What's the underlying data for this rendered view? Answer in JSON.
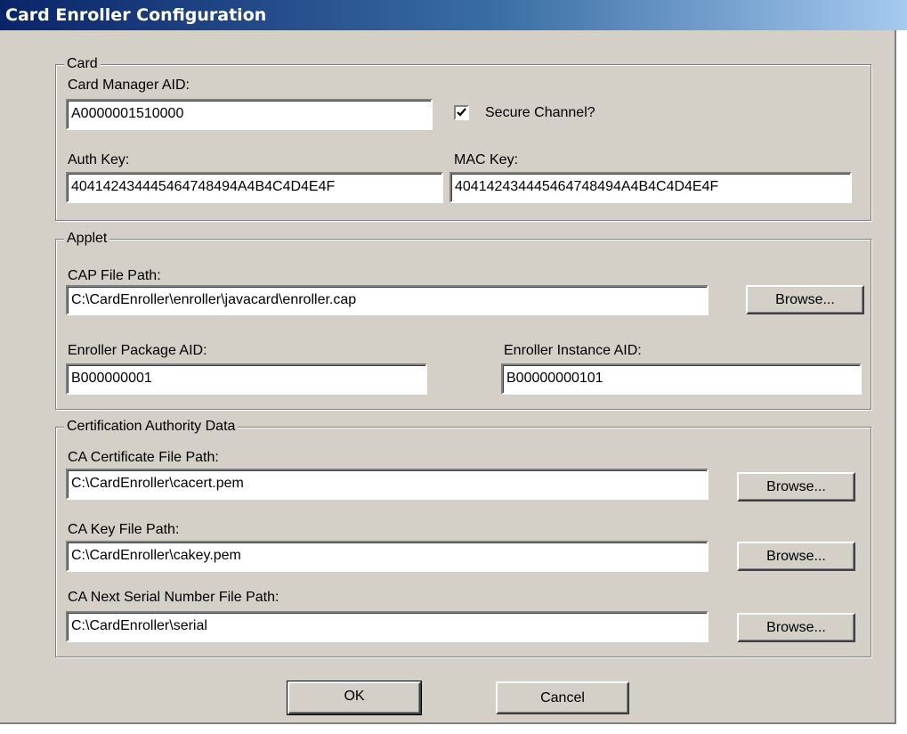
{
  "window": {
    "title": "Card Enroller Configuration"
  },
  "card": {
    "legend": "Card",
    "manager_aid_label": "Card Manager AID:",
    "manager_aid_value": "A0000001510000",
    "secure_channel_label": "Secure Channel?",
    "secure_channel_checked": true,
    "auth_key_label": "Auth Key:",
    "auth_key_value": "404142434445464748494A4B4C4D4E4F",
    "mac_key_label": "MAC Key:",
    "mac_key_value": "404142434445464748494A4B4C4D4E4F"
  },
  "applet": {
    "legend": "Applet",
    "cap_path_label": "CAP File Path:",
    "cap_path_value": "C:\\CardEnroller\\enroller\\javacard\\enroller.cap",
    "browse_label": "Browse...",
    "package_aid_label": "Enroller Package AID:",
    "package_aid_value": "B000000001",
    "instance_aid_label": "Enroller Instance AID:",
    "instance_aid_value": "B00000000101"
  },
  "ca": {
    "legend": "Certification Authority Data",
    "cert_path_label": "CA Certificate File Path:",
    "cert_path_value": "C:\\CardEnroller\\cacert.pem",
    "key_path_label": "CA Key File Path:",
    "key_path_value": "C:\\CardEnroller\\cakey.pem",
    "serial_path_label": "CA Next Serial Number File Path:",
    "serial_path_value": "C:\\CardEnroller\\serial",
    "browse_label": "Browse..."
  },
  "footer": {
    "ok_label": "OK",
    "cancel_label": "Cancel"
  },
  "colors": {
    "title_bar_start": "#0a246a",
    "title_bar_end": "#a6caf0",
    "dialog_face": "#d4d0c8"
  }
}
